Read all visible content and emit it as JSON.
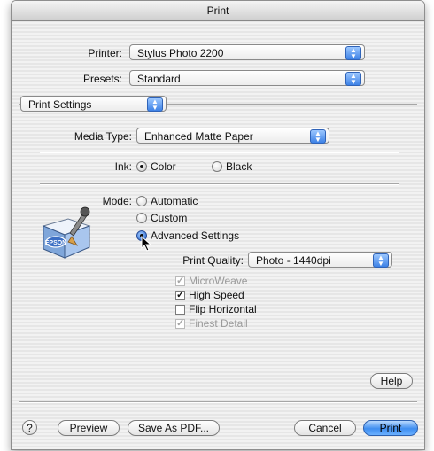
{
  "window": {
    "title": "Print"
  },
  "printer": {
    "label": "Printer:",
    "value": "Stylus Photo 2200"
  },
  "presets": {
    "label": "Presets:",
    "value": "Standard"
  },
  "panel": {
    "value": "Print Settings"
  },
  "media_type": {
    "label": "Media Type:",
    "value": "Enhanced Matte Paper"
  },
  "ink": {
    "label": "Ink:",
    "options": [
      "Color",
      "Black"
    ],
    "selected": "Color"
  },
  "mode": {
    "label": "Mode:",
    "options": [
      "Automatic",
      "Custom",
      "Advanced Settings"
    ],
    "selected": "Advanced Settings",
    "icon_text": "EPSON"
  },
  "print_quality": {
    "label": "Print Quality:",
    "value": "Photo - 1440dpi"
  },
  "checkboxes": [
    {
      "label": "MicroWeave",
      "checked": true,
      "enabled": false
    },
    {
      "label": "High Speed",
      "checked": true,
      "enabled": true
    },
    {
      "label": "Flip Horizontal",
      "checked": false,
      "enabled": true
    },
    {
      "label": "Finest Detail",
      "checked": true,
      "enabled": false
    }
  ],
  "buttons": {
    "help": "Help",
    "help_icon": "?",
    "preview": "Preview",
    "save_pdf": "Save As PDF...",
    "cancel": "Cancel",
    "print": "Print"
  },
  "colors": {
    "accent": "#3f8ef0",
    "window_bg": "#ececec"
  }
}
